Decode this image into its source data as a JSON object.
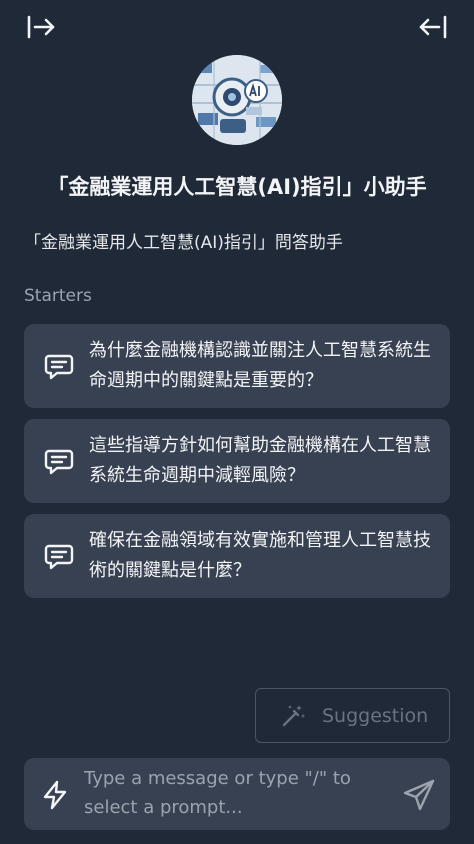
{
  "header": {
    "expand_icon": "arrow-right-to-bar-icon",
    "collapse_icon": "arrow-left-to-bar-icon"
  },
  "assistant": {
    "title": "「金融業運用人工智慧(AI)指引」小助手",
    "description": "「金融業運用人工智慧(AI)指引」問答助手"
  },
  "starters": {
    "label": "Starters",
    "items": [
      {
        "text": "為什麼金融機構認識並關注人工智慧系統生命週期中的關鍵點是重要的？",
        "icon": "message-square-icon"
      },
      {
        "text": "這些指導方針如何幫助金融機構在人工智慧系統生命週期中減輕風險？",
        "icon": "message-square-icon"
      },
      {
        "text": "確保在金融領域有效實施和管理人工智慧技術的關鍵點是什麼？",
        "icon": "message-square-icon"
      }
    ]
  },
  "suggestion": {
    "label": "Suggestion",
    "icon": "magic-wand-icon"
  },
  "composer": {
    "value": "",
    "placeholder": "Type a message or type \"/\" to select a prompt...",
    "left_icon": "bolt-icon",
    "send_icon": "send-icon"
  },
  "colors": {
    "background": "#1f2937",
    "card": "#374151",
    "text": "#f3f4f6",
    "muted": "#9ca3af"
  }
}
